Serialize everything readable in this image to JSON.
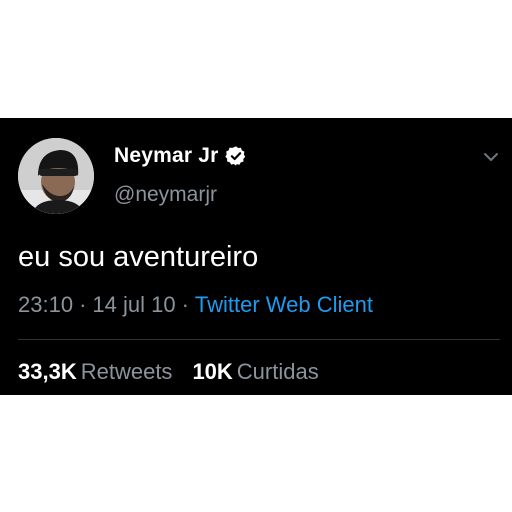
{
  "tweet": {
    "author": {
      "display_name": "Neymar Jr",
      "handle": "@neymarjr",
      "verified": true,
      "avatar_icon": "profile-photo"
    },
    "text": "eu sou aventureiro",
    "time": "23:10",
    "date": "14 jul 10",
    "separator": "·",
    "client": "Twitter Web Client",
    "stats": {
      "retweets_count": "33,3K",
      "retweets_label": "Retweets",
      "likes_count": "10K",
      "likes_label": "Curtidas"
    }
  },
  "colors": {
    "card_background": "#000000",
    "page_background": "#ffffff",
    "primary_text": "#ffffff",
    "secondary_text": "#8b949c",
    "link": "#1d9bf0",
    "divider": "#2f3336"
  },
  "icons": {
    "verified": "verified-badge-icon",
    "menu": "chevron-down-icon"
  }
}
